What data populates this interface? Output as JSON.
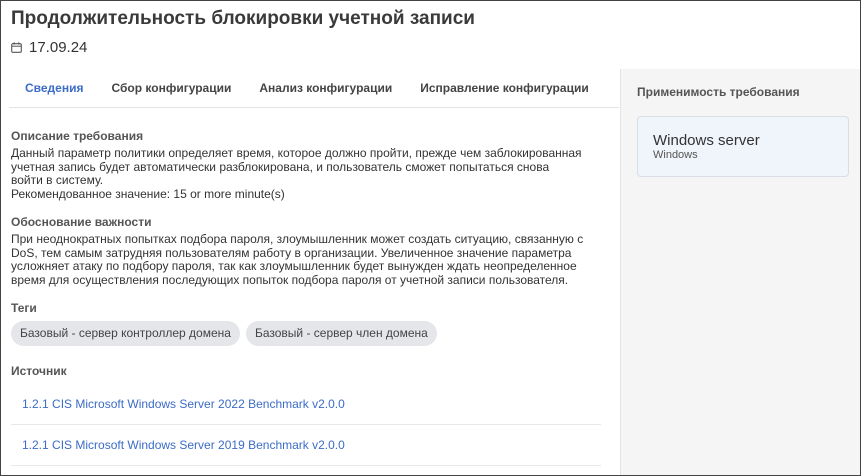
{
  "header": {
    "title": "Продолжительность блокировки учетной записи",
    "date": "17.09.24"
  },
  "tabs": [
    {
      "label": "Сведения",
      "active": true
    },
    {
      "label": "Сбор конфигурации",
      "active": false
    },
    {
      "label": "Анализ конфигурации",
      "active": false
    },
    {
      "label": "Исправление конфигурации",
      "active": false
    }
  ],
  "description": {
    "title": "Описание требования",
    "lines": [
      "Данный параметр политики определяет время, которое должно пройти, прежде чем заблокированная",
      "учетная запись будет автоматически разблокирована, и пользователь сможет попытаться снова",
      "войти в систему.",
      "Рекомендованное значение: 15 or more minute(s)"
    ]
  },
  "justification": {
    "title": "Обоснование важности",
    "lines": [
      "При неоднократных попытках подбора пароля, злоумышленник может создать ситуацию, связанную с",
      "DoS, тем самым затрудняя пользователям работу в организации. Увеличенное значение параметра",
      "усложняет атаку по подбору пароля, так как злоумышленник будет вынужден ждать неопределенное",
      "время для осуществления последующих попыток подбора пароля от учетной записи пользователя."
    ]
  },
  "tags": {
    "title": "Теги",
    "items": [
      "Базовый - сервер контроллер домена",
      "Базовый - сервер член домена"
    ]
  },
  "source": {
    "title": "Источник",
    "items": [
      "1.2.1 CIS Microsoft Windows Server 2022 Benchmark v2.0.0",
      "1.2.1 CIS Microsoft Windows Server 2019 Benchmark v2.0.0"
    ]
  },
  "applicability": {
    "title": "Применимость требования",
    "card_title": "Windows server",
    "card_subtitle": "Windows"
  },
  "colors": {
    "accent": "#3c6cc8",
    "tag_bg": "#e4e6ea",
    "right_pane_bg": "#f5f5f6"
  },
  "icons": {
    "date": "calendar-icon"
  }
}
